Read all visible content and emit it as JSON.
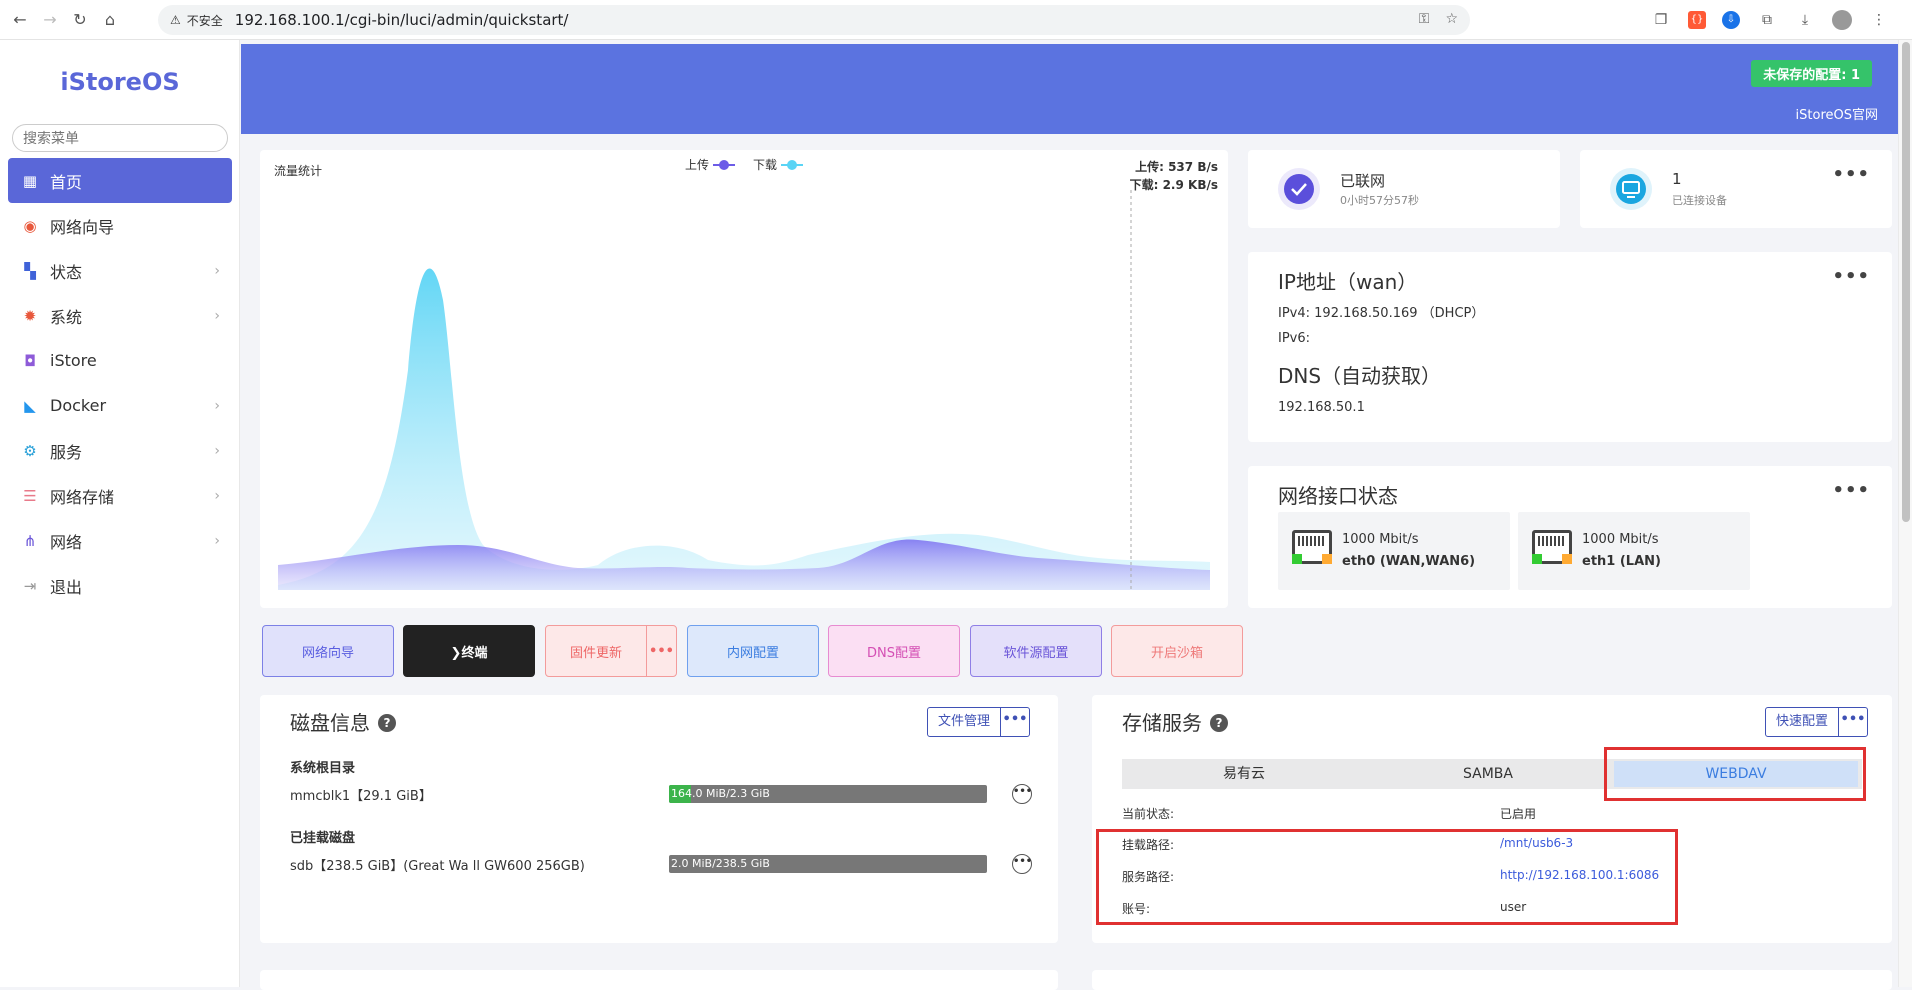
{
  "browser": {
    "security_label": "不安全",
    "url": "192.168.100.1/cgi-bin/luci/admin/quickstart/"
  },
  "sidebar": {
    "logo": "iStoreOS",
    "search_placeholder": "搜索菜单",
    "items": [
      {
        "label": "首页",
        "icon": "dashboard-icon"
      },
      {
        "label": "网络向导",
        "icon": "globe-icon"
      },
      {
        "label": "状态",
        "icon": "status-grid-icon"
      },
      {
        "label": "系统",
        "icon": "gear-icon"
      },
      {
        "label": "iStore",
        "icon": "bag-icon"
      },
      {
        "label": "Docker",
        "icon": "docker-icon"
      },
      {
        "label": "服务",
        "icon": "services-icon"
      },
      {
        "label": "网络存储",
        "icon": "database-icon"
      },
      {
        "label": "网络",
        "icon": "network-tree-icon"
      },
      {
        "label": "退出",
        "icon": "logout-icon"
      }
    ]
  },
  "header": {
    "unsaved": "未保存的配置: 1",
    "official_site": "iStoreOS官网"
  },
  "traffic": {
    "title": "流量统计",
    "legend_up": "上传",
    "legend_down": "下载",
    "up_rate": "上传: 537 B/s",
    "down_rate": "下载: 2.9 KB/s",
    "colors": {
      "upload": "#6c5ce7",
      "download": "#5ad4f5"
    }
  },
  "status": {
    "online_title": "已联网",
    "online_sub": "0小时57分57秒",
    "devices_count": "1",
    "devices_sub": "已连接设备"
  },
  "ip": {
    "title": "IP地址（wan）",
    "ipv4": "IPv4: 192.168.50.169 （DHCP）",
    "ipv6": "IPv6:",
    "dns_title": "DNS（自动获取）",
    "dns": "192.168.50.1"
  },
  "interfaces": {
    "title": "网络接口状态",
    "ports": [
      {
        "speed": "1000 Mbit/s",
        "name": "eth0 (WAN,WAN6)"
      },
      {
        "speed": "1000 Mbit/s",
        "name": "eth1 (LAN)"
      }
    ]
  },
  "quick": {
    "wizard": "网络向导",
    "terminal": "❯终端",
    "firmware": "固件更新",
    "lan": "内网配置",
    "dns": "DNS配置",
    "source": "软件源配置",
    "sandbox": "开启沙箱"
  },
  "disk": {
    "title": "磁盘信息",
    "file_btn": "文件管理",
    "root_title": "系统根目录",
    "root_name": "mmcblk1【29.1 GiB】",
    "root_usage": "164.0 MiB/2.3 GiB",
    "root_fraction": 0.07,
    "mounted_title": "已挂载磁盘",
    "mounted_name": "sdb【238.5 GiB】(Great Wa ll GW600 256GB)",
    "mounted_usage": "2.0 MiB/238.5 GiB",
    "mounted_fraction": 0.0
  },
  "storage": {
    "title": "存储服务",
    "quick_btn": "快速配置",
    "tabs": [
      "易有云",
      "SAMBA",
      "WEBDAV"
    ],
    "rows": [
      {
        "label": "当前状态:",
        "value": "已启用"
      },
      {
        "label": "挂载路径:",
        "value": "/mnt/usb6-3"
      },
      {
        "label": "服务路径:",
        "value": "http://192.168.100.1:6086"
      },
      {
        "label": "账号:",
        "value": "user"
      }
    ]
  }
}
